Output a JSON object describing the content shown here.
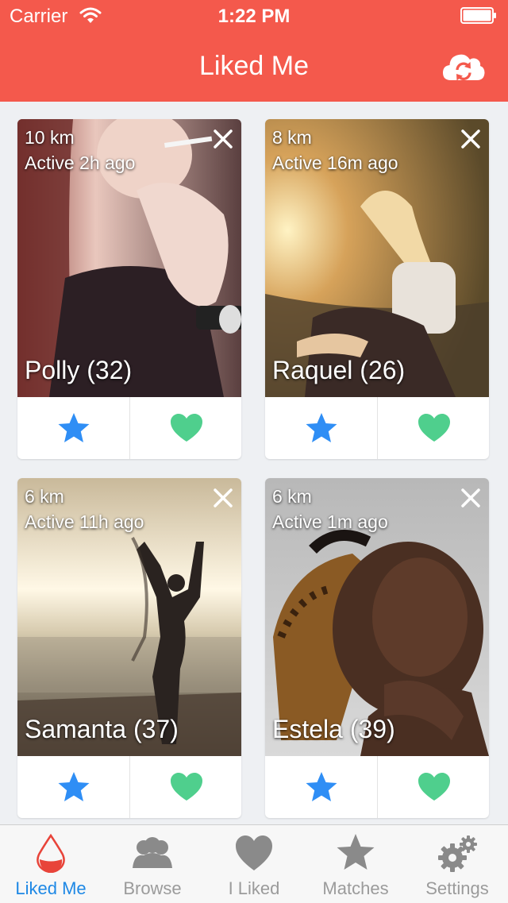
{
  "status_bar": {
    "carrier": "Carrier",
    "time": "1:22 PM"
  },
  "header": {
    "title": "Liked Me"
  },
  "cards": [
    {
      "distance": "10 km",
      "active": "Active 2h ago",
      "name": "Polly (32)"
    },
    {
      "distance": "8 km",
      "active": "Active 16m ago",
      "name": "Raquel (26)"
    },
    {
      "distance": "6 km",
      "active": "Active 11h ago",
      "name": "Samanta (37)"
    },
    {
      "distance": "6 km",
      "active": "Active 1m ago",
      "name": "Estela (39)"
    }
  ],
  "tabs": [
    {
      "label": "Liked Me",
      "icon": "drop-icon",
      "selected": true
    },
    {
      "label": "Browse",
      "icon": "people-icon",
      "selected": false
    },
    {
      "label": "I Liked",
      "icon": "heart-icon",
      "selected": false
    },
    {
      "label": "Matches",
      "icon": "star-icon",
      "selected": false
    },
    {
      "label": "Settings",
      "icon": "gears-icon",
      "selected": false
    }
  ],
  "colors": {
    "header": "#f4594c",
    "star": "#2f8ef5",
    "heart": "#4fcf8d",
    "tab_active": "#1e88e5",
    "tab_inactive": "#9b9b9b"
  }
}
